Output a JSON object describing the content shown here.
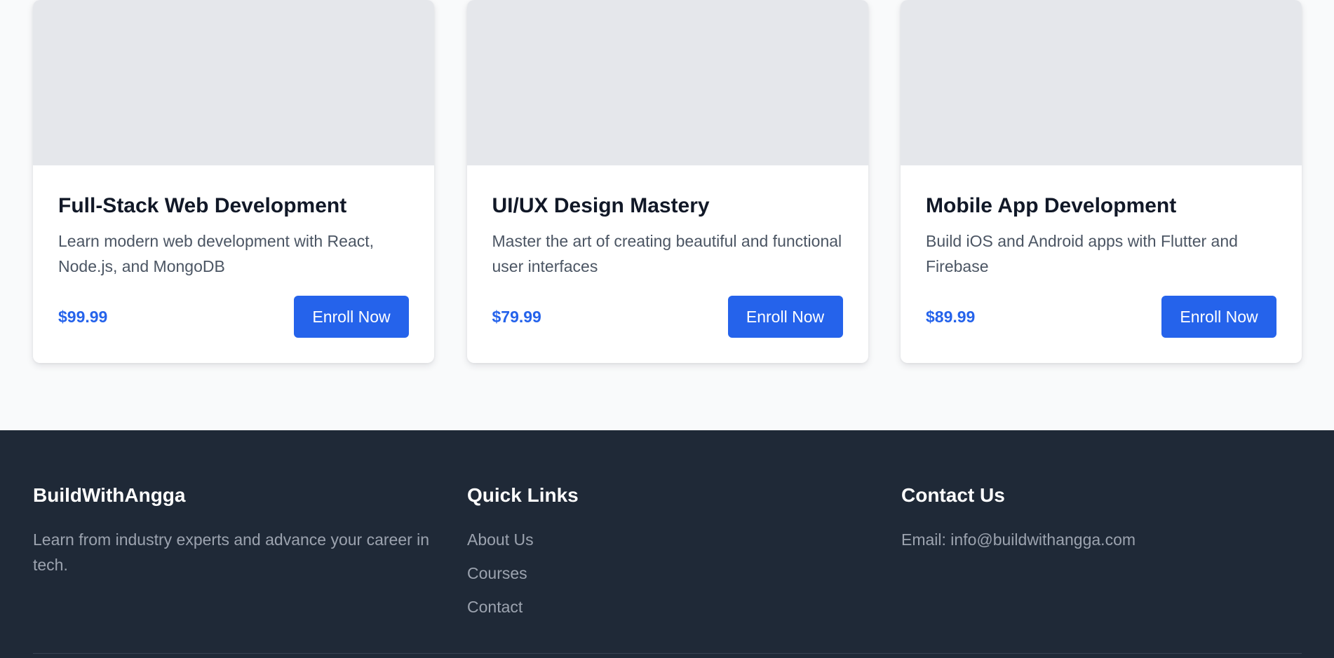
{
  "courses": [
    {
      "title": "Full-Stack Web Development",
      "description": "Learn modern web development with React, Node.js, and MongoDB",
      "price": "$99.99",
      "button_label": "Enroll Now"
    },
    {
      "title": "UI/UX Design Mastery",
      "description": "Master the art of creating beautiful and functional user interfaces",
      "price": "$79.99",
      "button_label": "Enroll Now"
    },
    {
      "title": "Mobile App Development",
      "description": "Build iOS and Android apps with Flutter and Firebase",
      "price": "$89.99",
      "button_label": "Enroll Now"
    }
  ],
  "footer": {
    "brand": {
      "title": "BuildWithAngga",
      "text": "Learn from industry experts and advance your career in tech."
    },
    "quick_links": {
      "title": "Quick Links",
      "links": [
        "About Us",
        "Courses",
        "Contact"
      ]
    },
    "contact": {
      "title": "Contact Us",
      "email": "Email: info@buildwithangga.com"
    }
  },
  "colors": {
    "accent": "#2563eb",
    "footer_bg": "#1f2937",
    "page_bg": "#f9fafb",
    "image_placeholder": "#e5e7eb"
  }
}
